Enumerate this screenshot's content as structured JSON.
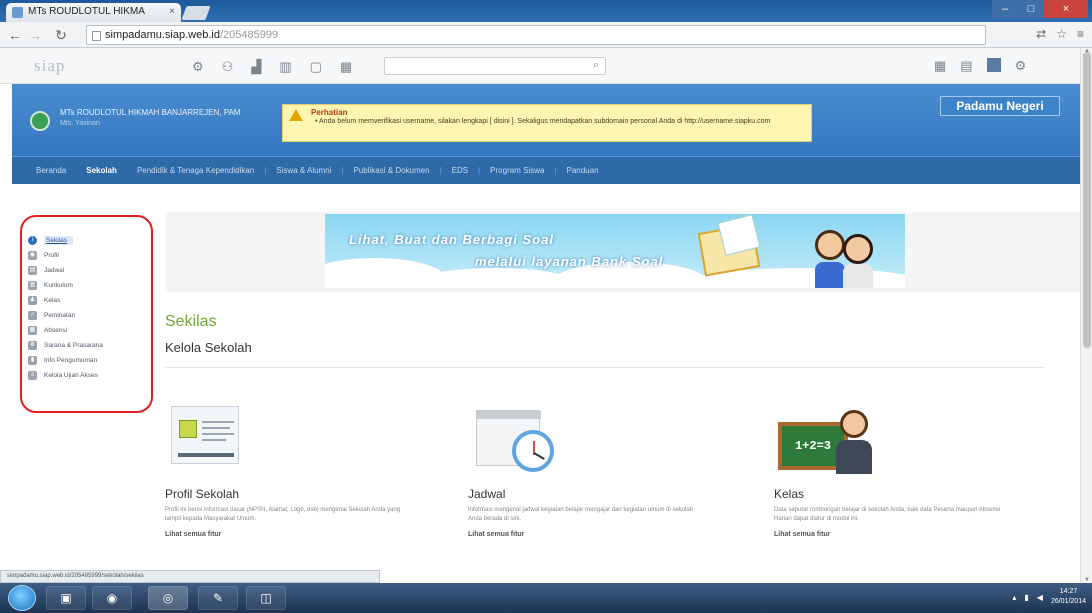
{
  "browser": {
    "tab_title": "MTs ROUDLOTUL HIKMA",
    "tab_close": "×",
    "url_main": "simpadamu.siap.web.id",
    "url_path": "/205485999",
    "window_controls": {
      "minimize": "–",
      "maximize": "□",
      "close": "×"
    }
  },
  "site": {
    "logo": "siap",
    "search_placeholder": ""
  },
  "banner": {
    "school_name": "MTs ROUDLOTUL HIKMAH BANJARREJEN, PAM",
    "school_sub": "Mts. Yasinan",
    "alert_title": "Perhatian",
    "alert_message": "• Anda belum memverifikasi username, silakan lengkapi [ disini ]. Sekaligus mendapatkan subdomain personal Anda di http://username.siapku.com",
    "padamu_button": "Padamu Negeri"
  },
  "mainnav": {
    "items": [
      {
        "label": "Beranda",
        "active": false
      },
      {
        "label": "Sekolah",
        "active": true
      },
      {
        "label": "Pendidik & Tenaga Kependidikan",
        "active": false
      },
      {
        "label": "Siswa & Alumni",
        "active": false
      },
      {
        "label": "Publikasi & Dokumen",
        "active": false
      },
      {
        "label": "EDS",
        "active": false
      },
      {
        "label": "Program Siswa",
        "active": false
      },
      {
        "label": "Panduan",
        "active": false
      }
    ]
  },
  "sidebar": {
    "items": [
      {
        "label": "Sekilas",
        "icon": "info-icon",
        "glyph": "i",
        "active": true
      },
      {
        "label": "Profil",
        "icon": "profile-icon",
        "glyph": "◉",
        "active": false
      },
      {
        "label": "Jadwal",
        "icon": "schedule-icon",
        "glyph": "▤",
        "active": false
      },
      {
        "label": "Kurikulum",
        "icon": "curriculum-icon",
        "glyph": "▥",
        "active": false
      },
      {
        "label": "Kelas",
        "icon": "class-icon",
        "glyph": "♟",
        "active": false
      },
      {
        "label": "Peminatan",
        "icon": "major-icon",
        "glyph": "✓",
        "active": false
      },
      {
        "label": "Absensi",
        "icon": "attendance-icon",
        "glyph": "▦",
        "active": false
      },
      {
        "label": "Sarana & Prasarana",
        "icon": "facility-icon",
        "glyph": "⚙",
        "active": false
      },
      {
        "label": "Info Pengumuman",
        "icon": "announcement-icon",
        "glyph": "▮",
        "active": false
      },
      {
        "label": "Kelola Ujian Akses",
        "icon": "exam-icon",
        "glyph": "≡",
        "active": false
      }
    ]
  },
  "promo": {
    "line1": "Lihat, Buat dan Berbagi Soal",
    "line2": "melalui layanan Bank Soal"
  },
  "section": {
    "title": "Sekilas",
    "subtitle": "Kelola Sekolah"
  },
  "cards": [
    {
      "title": "Profil Sekolah",
      "desc": "Profil ini berisi informasi dasar (NPSN, Alamat, Logo, dsb) mengenai Sekolah Anda yang tampil kepada Masyarakat Umum.",
      "more": "Lihat semua fitur"
    },
    {
      "title": "Jadwal",
      "desc": "Informasi mengenai jadwal kegiatan belajar mengajar dan kegiatan umum di sekolah Anda berada di sini.",
      "more": "Lihat semua fitur"
    },
    {
      "title": "Kelas",
      "desc": "Data seputar rombongan belajar di sekolah Anda, baik data Peserta maupun Absensi Harian dapat diatur di modul ini.",
      "more": "Lihat semua fitur",
      "board_text": "1+2=3"
    }
  ],
  "status": {
    "text": "simpadamu.siap.web.id/205485999/sekolah/sekilas"
  },
  "taskbar": {
    "apps": [
      "▣",
      "◉",
      "◎",
      "✎",
      "◫"
    ],
    "time": "14:27",
    "date": "26/01/2014"
  },
  "colors": {
    "brand_blue": "#3477c0",
    "nav_blue": "#2f6aa8",
    "accent_green": "#6fa832",
    "highlight_red": "#e02020"
  }
}
